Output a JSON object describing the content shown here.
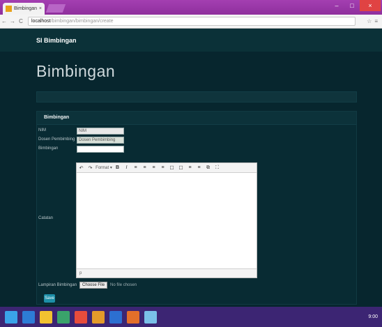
{
  "browser": {
    "tab_title": "Bimbingan",
    "tab_close": "×",
    "window_controls": [
      "–",
      "□",
      "×"
    ],
    "nav": {
      "back": "←",
      "forward": "→",
      "reload": "C"
    },
    "url_host": "localhost",
    "url_path": "/bimbingan/bimbingan/create",
    "toolbar_right": [
      "☆",
      "≡"
    ]
  },
  "app": {
    "brand": "SI Bimbingan",
    "page_title": "Bimbingan",
    "panel_title": "Bimbingan",
    "form": {
      "labels": [
        "NIM",
        "Dosen Pembimbing",
        "Bimbingan",
        "Catatan"
      ],
      "nim_value": "NIM",
      "dosen_value": "Dosen Pembimbing",
      "bimbingan_value": ""
    },
    "editor": {
      "toolbar": [
        "↶",
        "↷",
        "Format ▾",
        "B",
        "I",
        "≡",
        "≡",
        "≡",
        "≡",
        "☐",
        "☐",
        "≡",
        "≡",
        "⧉",
        "⛶"
      ],
      "status": "p"
    },
    "file_label": "Lampiran Bimbingan",
    "file_button": "Choose File",
    "file_note": "No file chosen",
    "submit_label": "Save"
  },
  "taskbar": {
    "icons": [
      "windows-start-icon",
      "ie-icon",
      "explorer-icon",
      "store-icon",
      "chrome-icon",
      "files-icon",
      "word-icon",
      "paint-icon",
      "media-icon"
    ],
    "icon_colors": [
      "#3aa3e8",
      "#2d7cd6",
      "#f2c230",
      "#3aa36b",
      "#e74c3c",
      "#e39b2a",
      "#2c6fd1",
      "#e36f2a",
      "#7ac0e8"
    ],
    "clock": "9:00"
  },
  "colors": {
    "page_bg": "#07262e",
    "accent": "#1d8fa8"
  }
}
